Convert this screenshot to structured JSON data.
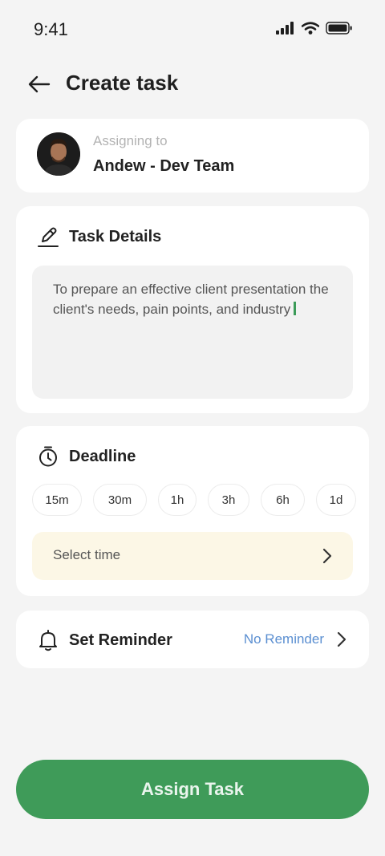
{
  "status_bar": {
    "time": "9:41",
    "icons": [
      "signal-icon",
      "wifi-icon",
      "battery-icon"
    ]
  },
  "header": {
    "title": "Create task",
    "back_icon": "arrow-left-icon"
  },
  "assignee": {
    "label": "Assigning to",
    "name": "Andew - Dev Team"
  },
  "task_details": {
    "icon": "pencil-icon",
    "title": "Task Details",
    "text": "To prepare an effective client presentation the client's needs, pain points, and industry"
  },
  "deadline": {
    "icon": "stopwatch-icon",
    "title": "Deadline",
    "chips": [
      "15m",
      "30m",
      "1h",
      "3h",
      "6h",
      "1d"
    ],
    "select_time": "Select time"
  },
  "reminder": {
    "icon": "bell-icon",
    "title": "Set Reminder",
    "value": "No Reminder"
  },
  "primary_action": {
    "label": "Assign Task"
  },
  "colors": {
    "background": "#f4f4f4",
    "card": "#ffffff",
    "accent_green": "#3f9b59",
    "link_blue": "#5b8fd1",
    "select_time_bg": "#fcf7e6"
  }
}
